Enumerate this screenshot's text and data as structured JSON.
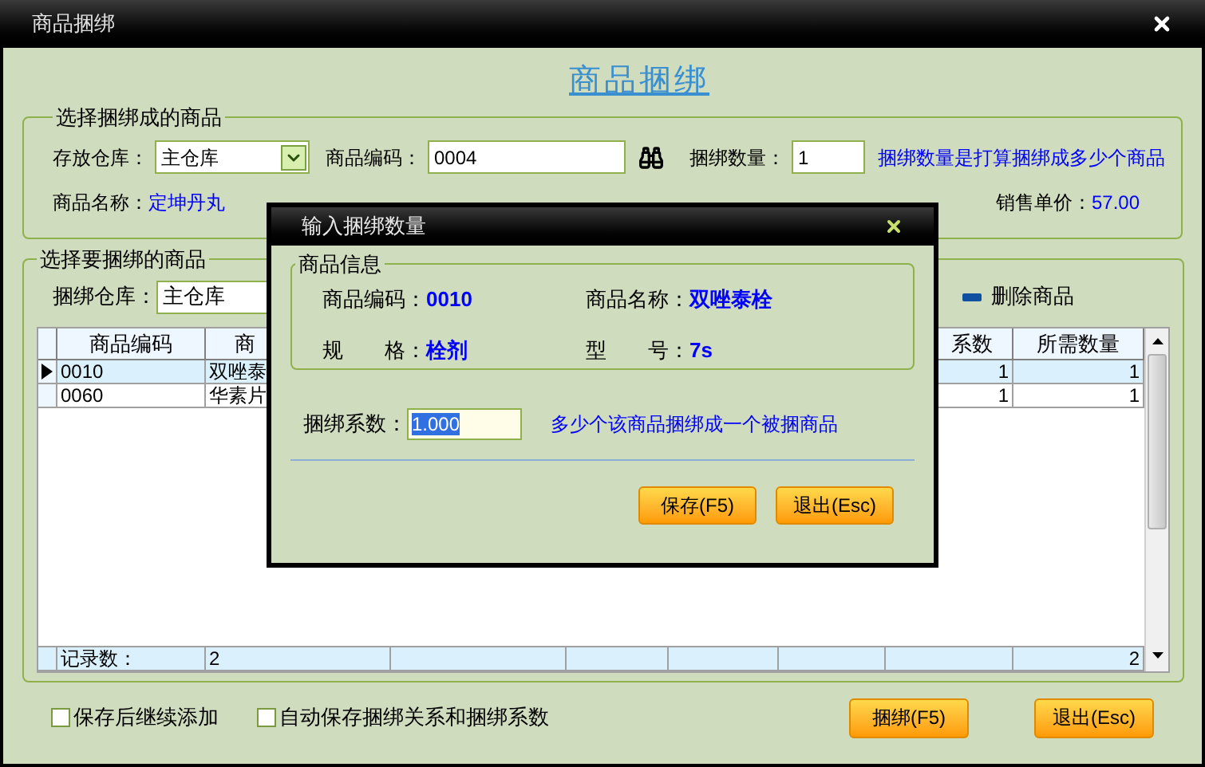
{
  "window": {
    "title": "商品捆绑",
    "heading": "商品捆绑"
  },
  "target": {
    "legend": "选择捆绑成的商品",
    "warehouse_label": "存放仓库：",
    "warehouse": "主仓库",
    "code_label": "商品编码：",
    "code": "0004",
    "qty_label": "捆绑数量：",
    "qty": "1",
    "hint": "捆绑数量是打算捆绑成多少个商品",
    "name_label": "商品名称：",
    "name": "定坤丹丸",
    "price_label": "销售单价：",
    "price": "57.00"
  },
  "source": {
    "legend": "选择要捆绑的商品",
    "warehouse_label": "捆绑仓库：",
    "warehouse": "主仓库",
    "delete_button": "删除商品",
    "columns": {
      "code": "商品编码",
      "name": "商",
      "factor": "系数",
      "quantity": "所需数量"
    },
    "rows": [
      {
        "selected": true,
        "code": "0010",
        "name": "双唑泰",
        "factor": "1",
        "quantity": "1"
      },
      {
        "selected": false,
        "code": "0060",
        "name": "华素片",
        "factor": "1",
        "quantity": "1"
      }
    ],
    "footer": {
      "label": "记录数：",
      "count": "2",
      "total": "2"
    }
  },
  "options": [
    {
      "label": "保存后继续添加",
      "checked": false
    },
    {
      "label": "自动保存捆绑关系和捆绑系数",
      "checked": false
    }
  ],
  "buttons": [
    "捆绑(F5)",
    "退出(Esc)"
  ],
  "dialog": {
    "title": "输入捆绑数量",
    "legend": "商品信息",
    "code_label": "商品编码：",
    "code": "0010",
    "name_label": "商品名称：",
    "name": "双唑泰栓",
    "spec_label": "规　　格：",
    "spec": "栓剂",
    "model_label": "型　　号：",
    "model": "7s",
    "factor_label": "捆绑系数：",
    "factor": "1.000",
    "factor_hint": "多少个该商品捆绑成一个被捆商品",
    "buttons": [
      "保存(F5)",
      "退出(Esc)"
    ]
  }
}
